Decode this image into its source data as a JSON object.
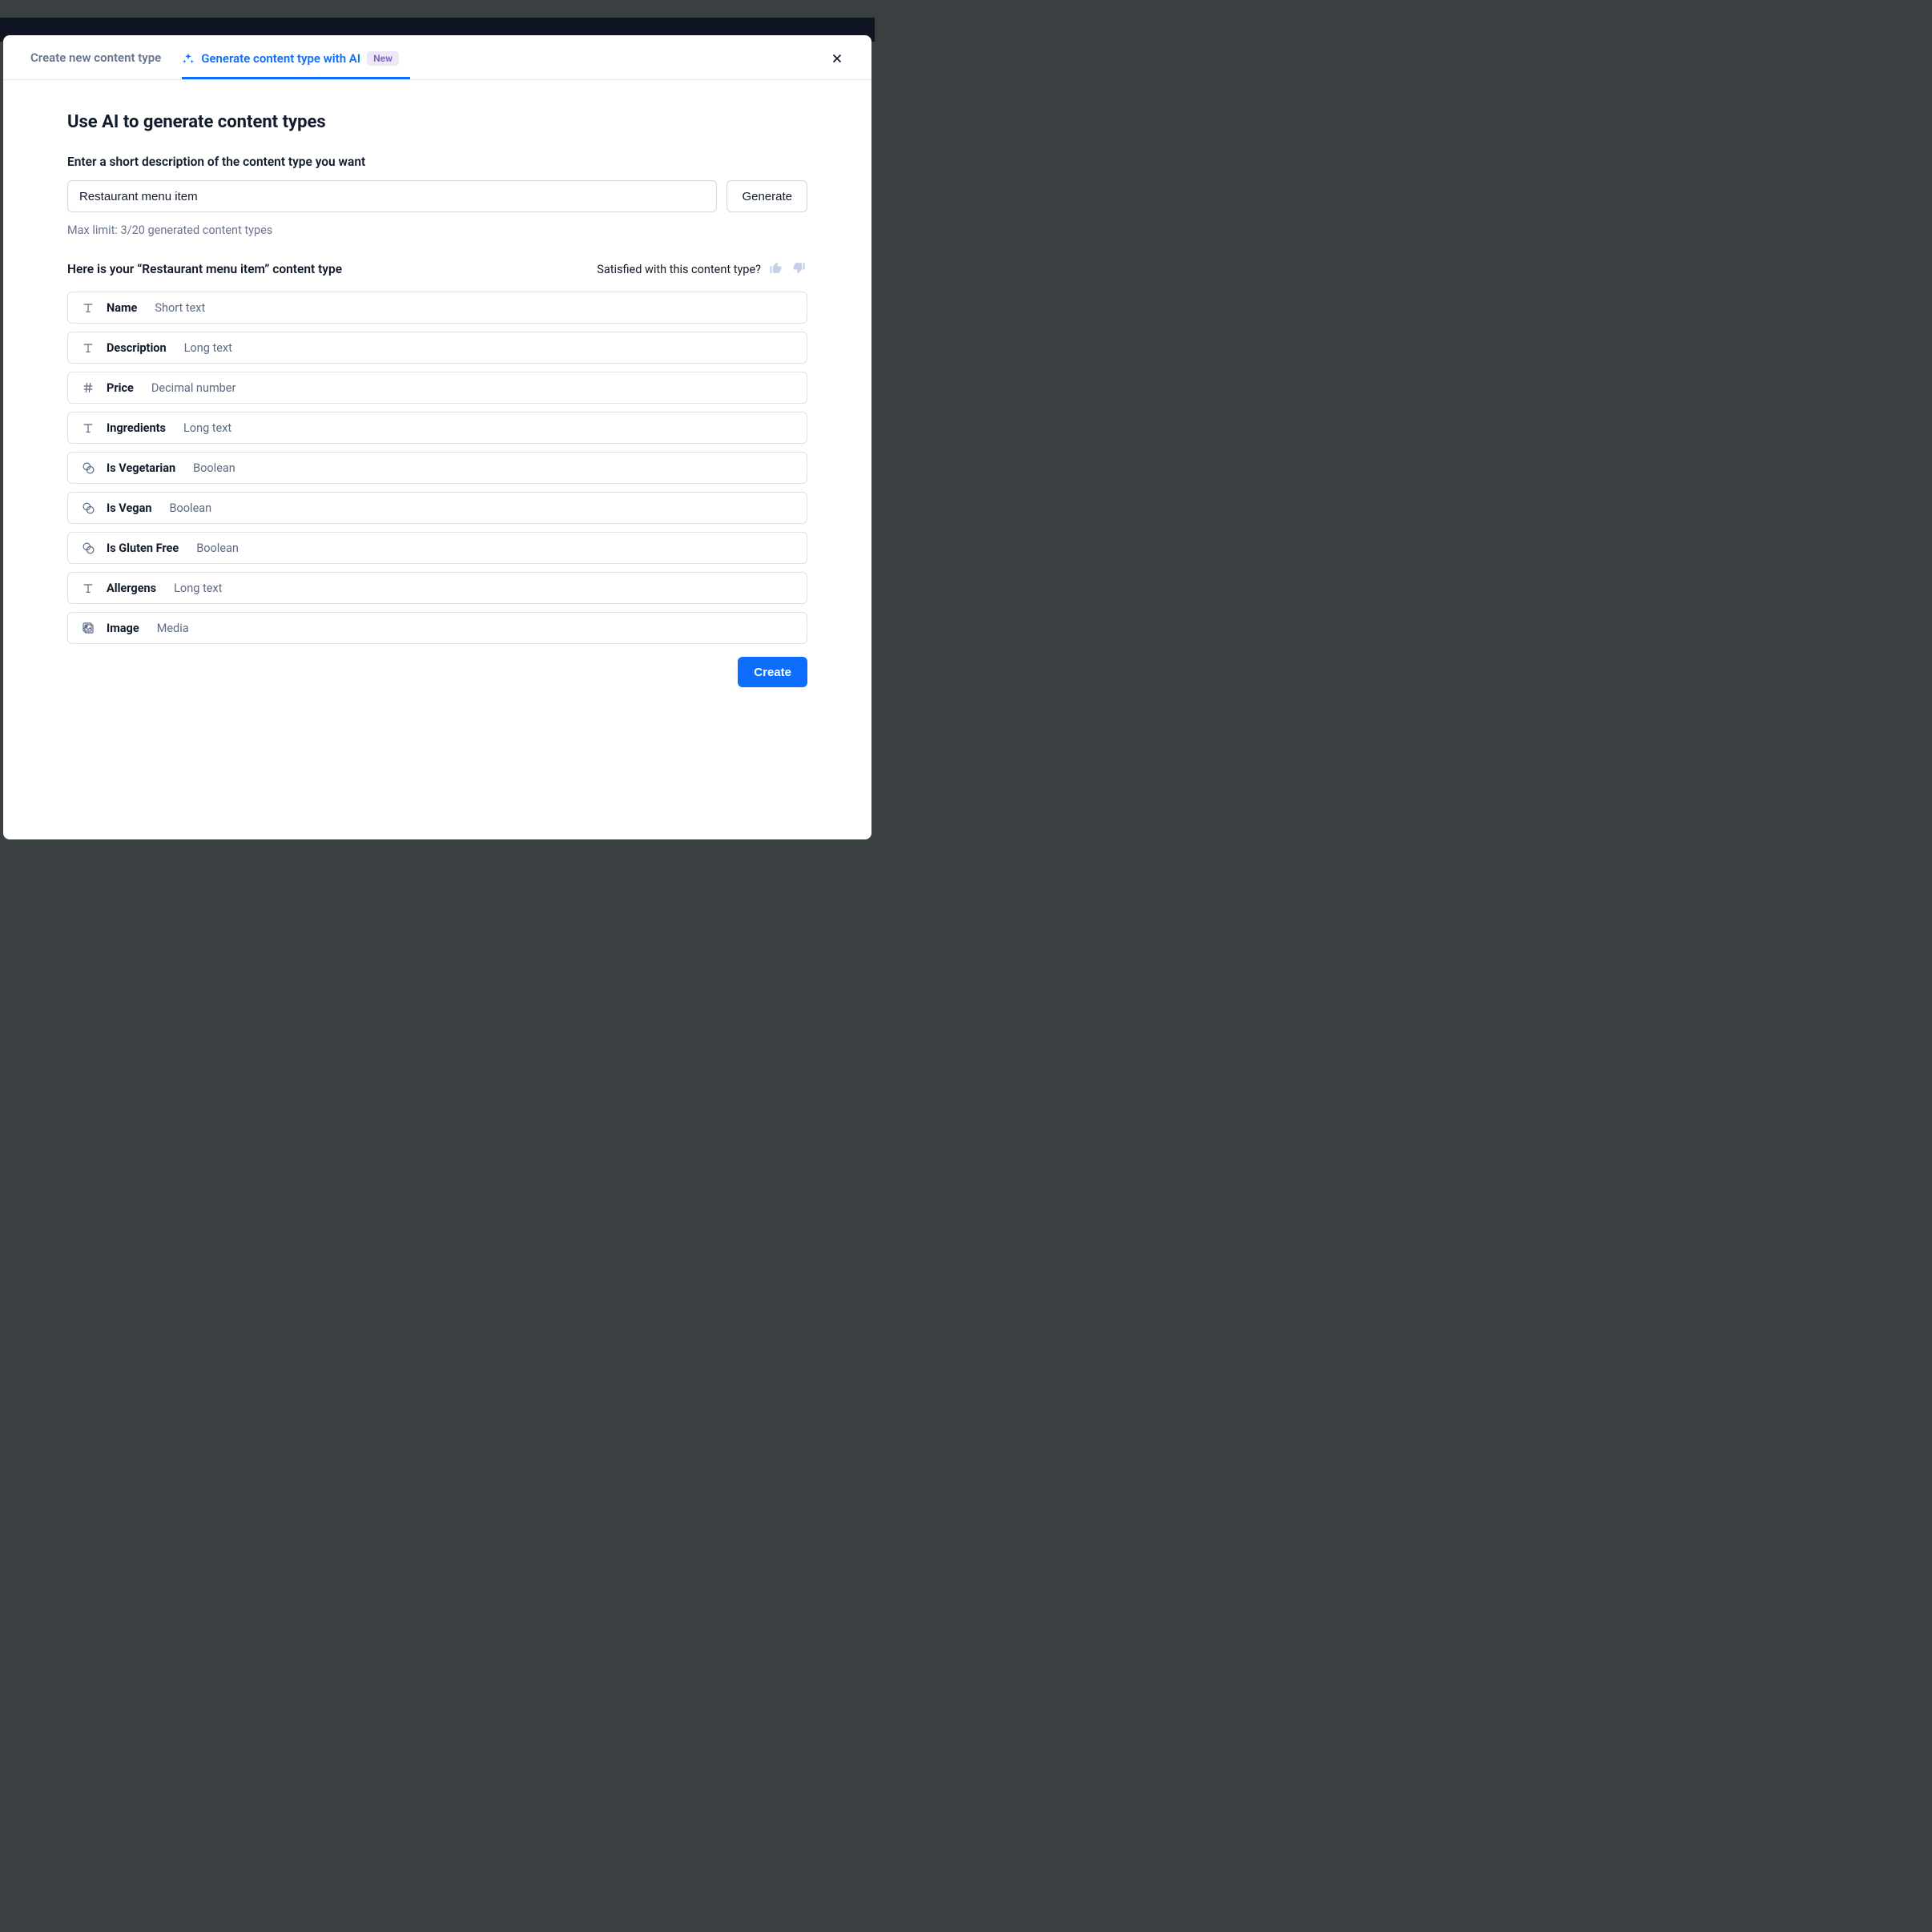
{
  "tabs": {
    "create": "Create new content type",
    "generate": "Generate content type with AI",
    "badge": "New"
  },
  "page": {
    "title": "Use AI to generate content types",
    "input_label": "Enter a short description of the content type you want",
    "input_value": "Restaurant menu item",
    "generate_button": "Generate",
    "hint": "Max limit: 3/20 generated content types",
    "result_title": "Here is your “Restaurant menu item” content type",
    "feedback_label": "Satisfied with this content type?",
    "create_button": "Create"
  },
  "fields": [
    {
      "icon": "text",
      "name": "Name",
      "type": "Short text"
    },
    {
      "icon": "text",
      "name": "Description",
      "type": "Long text"
    },
    {
      "icon": "number",
      "name": "Price",
      "type": "Decimal number"
    },
    {
      "icon": "text",
      "name": "Ingredients",
      "type": "Long text"
    },
    {
      "icon": "boolean",
      "name": "Is Vegetarian",
      "type": "Boolean"
    },
    {
      "icon": "boolean",
      "name": "Is Vegan",
      "type": "Boolean"
    },
    {
      "icon": "boolean",
      "name": "Is Gluten Free",
      "type": "Boolean"
    },
    {
      "icon": "text",
      "name": "Allergens",
      "type": "Long text"
    },
    {
      "icon": "media",
      "name": "Image",
      "type": "Media"
    }
  ]
}
